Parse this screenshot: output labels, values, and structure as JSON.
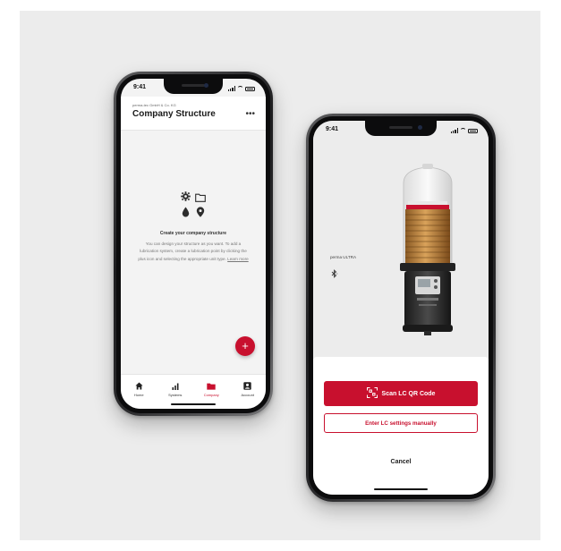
{
  "colors": {
    "brand": "#c8102e",
    "background": "#ececec"
  },
  "left_phone": {
    "status": {
      "time": "9:41"
    },
    "header": {
      "company": "perma-tec GmbH & Co. KG",
      "title": "Company Structure",
      "more_icon": "ellipsis-icon"
    },
    "empty_state": {
      "icons": [
        "gear-icon",
        "folder-icon",
        "drop-icon",
        "location-pin-icon"
      ],
      "heading": "Create your company structure",
      "description": "You can design your structure as you want. To add a lubrication system, create a lubrication point by clicking the plus icon and selecting the appropriate unit type.",
      "learn_more": "Learn more"
    },
    "fab": {
      "label": "+",
      "icon": "plus-icon"
    },
    "tabs": [
      {
        "label": "Home",
        "icon": "home-icon",
        "active": false
      },
      {
        "label": "Systems",
        "icon": "bar-chart-icon",
        "active": false
      },
      {
        "label": "Company",
        "icon": "folder-icon",
        "active": true
      },
      {
        "label": "Account",
        "icon": "account-icon",
        "active": false
      }
    ]
  },
  "right_phone": {
    "status": {
      "time": "9:41"
    },
    "product": {
      "name": "perma ULTRA",
      "bluetooth_icon": "bluetooth-icon"
    },
    "actions": {
      "scan_label": "Scan LC QR Code",
      "scan_icon": "qr-scan-icon",
      "manual_label": "Enter LC settings manually",
      "cancel_label": "Cancel"
    }
  }
}
